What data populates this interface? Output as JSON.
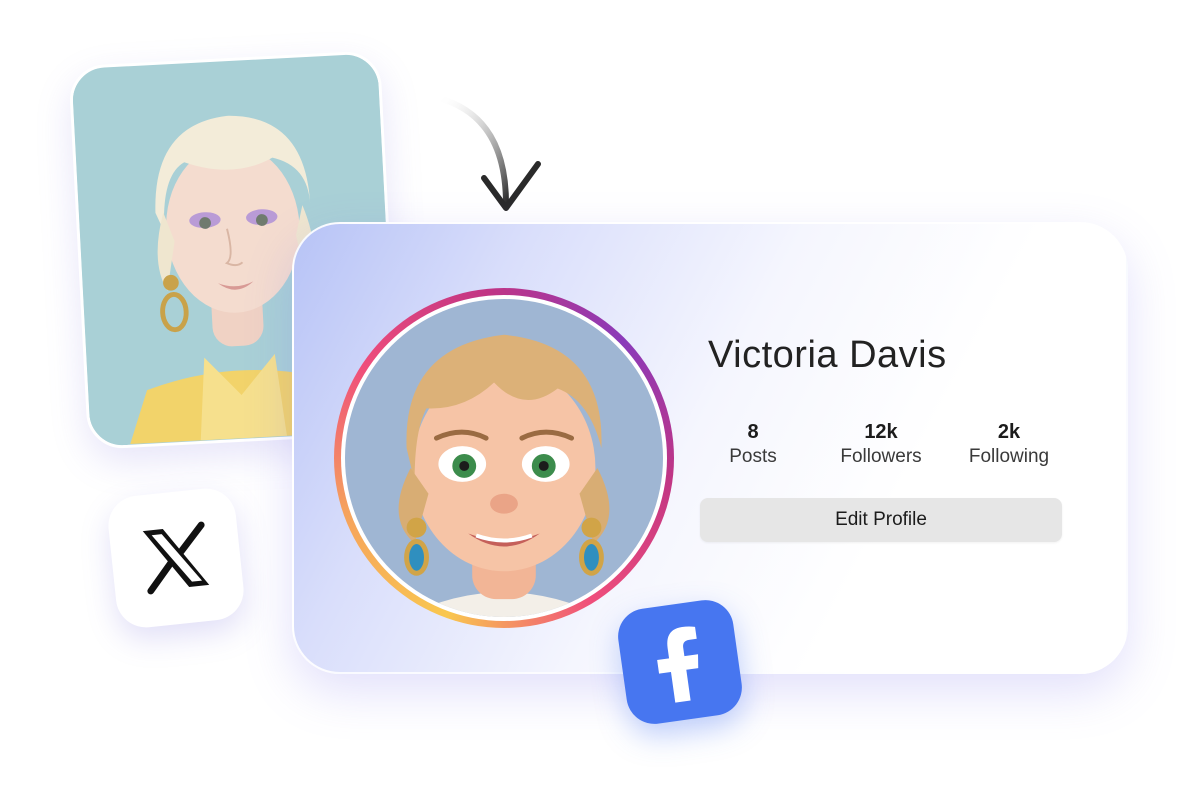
{
  "profile": {
    "name": "Victoria Davis",
    "stats": [
      {
        "value": "8",
        "label": "Posts"
      },
      {
        "value": "12k",
        "label": "Followers"
      },
      {
        "value": "2k",
        "label": "Following"
      }
    ],
    "edit_button_label": "Edit Profile"
  },
  "icons": {
    "arrow": "curved-arrow-icon",
    "x_logo": "x-logo-icon",
    "facebook_logo": "facebook-logo-icon"
  },
  "colors": {
    "facebook_blue": "#4776f0",
    "avatar_ring_start": "#f9c74f",
    "avatar_ring_mid": "#ef4e7b",
    "avatar_ring_end": "#8a3ab9",
    "button_bg": "#e6e6e6"
  }
}
